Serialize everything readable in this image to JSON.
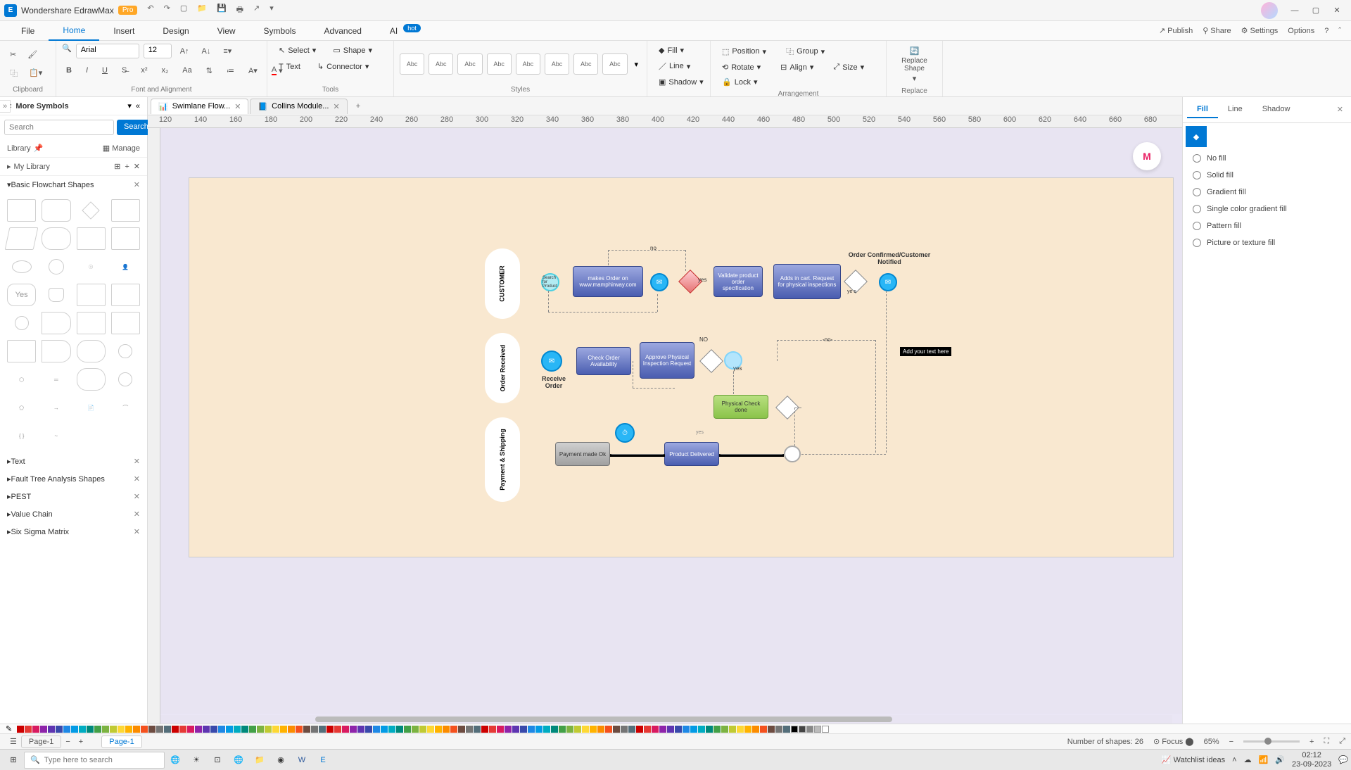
{
  "titlebar": {
    "app": "Wondershare EdrawMax",
    "badge": "Pro"
  },
  "menubar": {
    "items": [
      "File",
      "Home",
      "Insert",
      "Design",
      "View",
      "Symbols",
      "Advanced",
      "AI"
    ],
    "active": 1,
    "ai_hot": "hot",
    "right": {
      "publish": "Publish",
      "share": "Share",
      "settings": "Settings",
      "options": "Options"
    }
  },
  "ribbon": {
    "clipboard": {
      "label": "Clipboard"
    },
    "font": {
      "name": "Arial",
      "size": "12",
      "label": "Font and Alignment"
    },
    "tools": {
      "select": "Select",
      "shape": "Shape",
      "text": "Text",
      "connector": "Connector",
      "label": "Tools"
    },
    "styles": {
      "thumb": "Abc",
      "count": 8,
      "label": "Styles"
    },
    "effects": {
      "fill": "Fill",
      "line": "Line",
      "shadow": "Shadow"
    },
    "arrange": {
      "position": "Position",
      "align": "Align",
      "group": "Group",
      "size": "Size",
      "rotate": "Rotate",
      "lock": "Lock",
      "label": "Arrangement"
    },
    "replace": {
      "shape": "Replace Shape",
      "label": "Replace"
    }
  },
  "left_panel": {
    "title": "More Symbols",
    "search_ph": "Search",
    "search_btn": "Search",
    "library": "Library",
    "manage": "Manage",
    "mylib": "My Library",
    "sections": [
      "Basic Flowchart Shapes",
      "Text",
      "Fault Tree Analysis Shapes",
      "PEST",
      "Value Chain",
      "Six Sigma Matrix"
    ],
    "yes": "Yes"
  },
  "doc_tabs": {
    "t1": "Swimlane Flow...",
    "t2": "Collins Module..."
  },
  "canvas": {
    "lane1": "CUSTOMER",
    "lane2": "Order Received",
    "lane3": "Payment & Shipping",
    "node_make": "makes Order on www.mamphirway.com",
    "node_validate": "Validate product order specification",
    "node_addcart": "Adds in cart. Request for physical inspections",
    "node_confirmed": "Order Confirmed/Customer Notified",
    "node_check": "Check Order Availability",
    "node_approve": "Approve Physical Inspection Request",
    "node_receive": "Receive Order",
    "node_physical": "Physical Check done",
    "node_payment": "Payment made Ok",
    "node_delivered": "Product Delivered",
    "lbl_no": "no",
    "lbl_no2": "NO",
    "lbl_no3": "-no-",
    "lbl_yes": "yes",
    "lbl_yes2": "yes",
    "lbl_yes3": "ye s",
    "add_text": "Add your text here",
    "search_prod": "Search for Product"
  },
  "right_panel": {
    "tabs": [
      "Fill",
      "Line",
      "Shadow"
    ],
    "active": 0,
    "opts": [
      "No fill",
      "Solid fill",
      "Gradient fill",
      "Single color gradient fill",
      "Pattern fill",
      "Picture or texture fill"
    ]
  },
  "statusbar": {
    "page_sel": "Page-1",
    "page_tab": "Page-1",
    "shapes": "Number of shapes: 26",
    "focus": "Focus",
    "zoom": "65%"
  },
  "taskbar": {
    "search": "Type here to search",
    "watchlist": "Watchlist ideas",
    "time": "02:12",
    "date": "23-09-2023"
  },
  "ruler": [
    "120",
    "140",
    "160",
    "180",
    "200",
    "220",
    "240",
    "260",
    "280",
    "300",
    "320",
    "340",
    "360",
    "380",
    "400",
    "420",
    "440",
    "460",
    "480",
    "500",
    "520",
    "540",
    "560",
    "580",
    "600",
    "620",
    "640",
    "660",
    "680"
  ]
}
